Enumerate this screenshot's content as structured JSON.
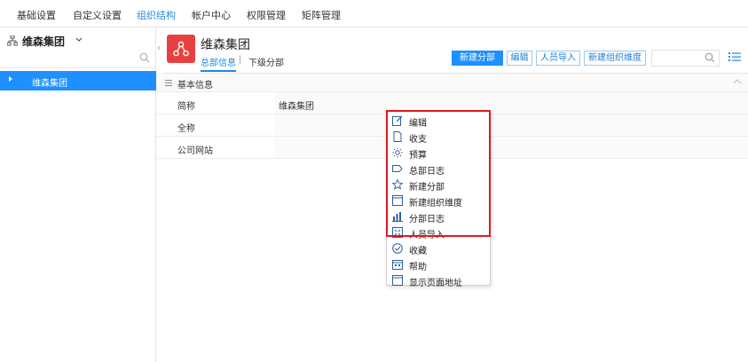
{
  "topnav": {
    "tabs": [
      {
        "label": "基础设置"
      },
      {
        "label": "自定义设置"
      },
      {
        "label": "组织结构"
      },
      {
        "label": "帐户中心"
      },
      {
        "label": "权限管理"
      },
      {
        "label": "矩阵管理"
      }
    ],
    "active_index": 2
  },
  "sidebar": {
    "title": "维森集团",
    "search_placeholder": "",
    "items": [
      {
        "label": "维森集团"
      }
    ]
  },
  "header": {
    "org_name": "维森集团",
    "subtabs": [
      {
        "label": "总部信息"
      },
      {
        "label": "下级分部"
      }
    ],
    "separator": "|",
    "buttons": [
      {
        "label": "新建分部"
      },
      {
        "label": "编辑"
      },
      {
        "label": "人员导入"
      },
      {
        "label": "新建组织维度"
      }
    ],
    "search_value": ""
  },
  "section": {
    "title": "基本信息",
    "rows": [
      {
        "label": "简称",
        "value": "维森集团"
      },
      {
        "label": "全称",
        "value": ""
      },
      {
        "label": "公司网站",
        "value": ""
      }
    ]
  },
  "context_menu": {
    "items": [
      {
        "label": "编辑",
        "icon": "edit-icon"
      },
      {
        "label": "收支",
        "icon": "document-icon"
      },
      {
        "label": "预算",
        "icon": "sun-icon"
      },
      {
        "label": "总部日志",
        "icon": "tag-icon"
      },
      {
        "label": "新建分部",
        "icon": "star-icon"
      },
      {
        "label": "新建组织维度",
        "icon": "window-icon"
      },
      {
        "label": "分部日志",
        "icon": "bar-chart-icon"
      },
      {
        "label": "人员导入",
        "icon": "expand-icon"
      },
      {
        "label": "收藏",
        "icon": "check-circle-icon"
      },
      {
        "label": "帮助",
        "icon": "calendar-icon"
      },
      {
        "label": "显示页面地址",
        "icon": "window-icon"
      }
    ],
    "highlight_color": "#e0191f"
  },
  "colors": {
    "accent": "#1e90ff",
    "logo_bg": "#e84040"
  }
}
